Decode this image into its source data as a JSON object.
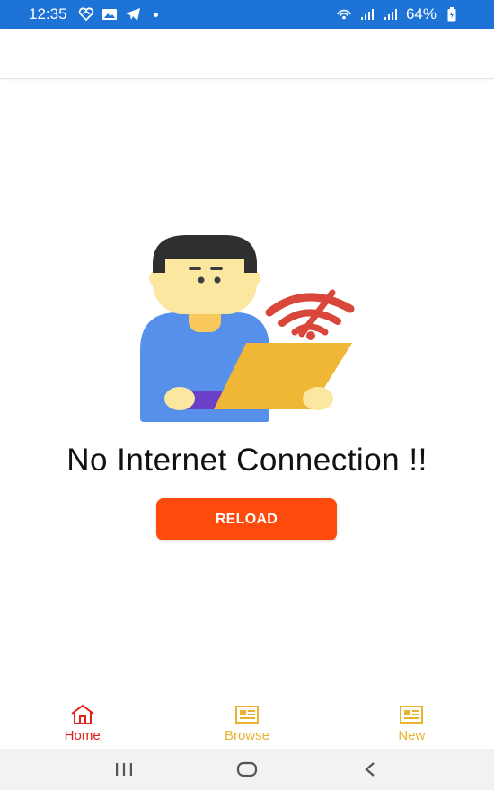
{
  "status_bar": {
    "time": "12:35",
    "battery": "64%",
    "left_icons": [
      "heart-wireless-icon",
      "image-icon",
      "telegram-icon",
      "dot-icon"
    ],
    "right_icons": [
      "hotspot-icon",
      "signal-icon",
      "signal-icon",
      "battery-icon"
    ]
  },
  "main": {
    "message": "No Internet Connection !!",
    "reload_label": "RELOAD",
    "illustration": "person-with-laptop-no-wifi-illustration"
  },
  "bottom_nav": {
    "items": [
      {
        "label": "Home",
        "icon": "home-icon",
        "active": true
      },
      {
        "label": "Browse",
        "icon": "newspaper-icon",
        "active": false
      },
      {
        "label": "New",
        "icon": "newspaper-icon",
        "active": false
      }
    ]
  },
  "system_nav": [
    "recents-button",
    "home-button",
    "back-button"
  ],
  "colors": {
    "status_bar": "#1e73d6",
    "accent_button": "#ff4a0d",
    "nav_active": "#e0201b",
    "nav_inactive": "#e8b22e"
  }
}
